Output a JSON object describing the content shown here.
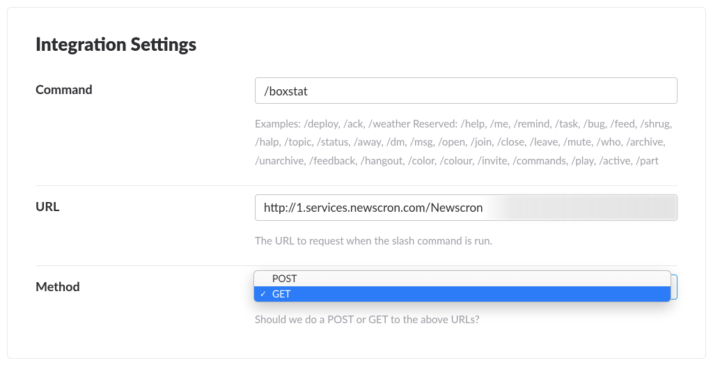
{
  "page_title": "Integration Settings",
  "command": {
    "label": "Command",
    "value": "/boxstat",
    "help": "Examples: /deploy, /ack, /weather Reserved: /help, /me, /remind, /task, /bug, /feed, /shrug, /halp, /topic, /status, /away, /dm, /msg, /open, /join, /close, /leave, /mute, /who, /archive, /unarchive, /feedback, /hangout, /color, /colour, /invite, /commands, /play, /active, /part"
  },
  "url": {
    "label": "URL",
    "value": "http://1.services.newscron.com/Newscron",
    "help": "The URL to request when the slash command is run."
  },
  "method": {
    "label": "Method",
    "option_post": "POST",
    "option_get": "GET",
    "selected": "GET",
    "help": "Should we do a POST or GET to the above URLs?"
  }
}
